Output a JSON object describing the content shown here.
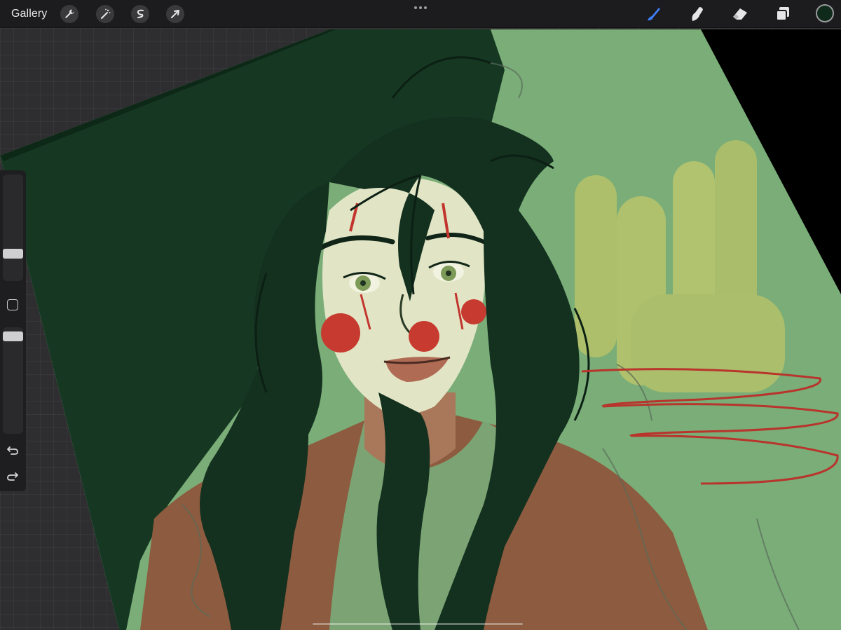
{
  "toolbar": {
    "gallery_label": "Gallery",
    "left_tools": [
      {
        "name": "actions",
        "icon": "wrench-icon"
      },
      {
        "name": "adjustments",
        "icon": "magic-wand-icon"
      },
      {
        "name": "selection",
        "icon": "selection-s-icon"
      },
      {
        "name": "transform",
        "icon": "arrow-cursor-icon"
      }
    ],
    "more_icon": "more-dots-icon",
    "right_tools": [
      {
        "name": "brush",
        "icon": "brush-icon",
        "active": true
      },
      {
        "name": "smudge",
        "icon": "smudge-icon",
        "active": false
      },
      {
        "name": "eraser",
        "icon": "eraser-icon",
        "active": false
      },
      {
        "name": "layers",
        "icon": "layers-icon",
        "active": false
      }
    ],
    "current_color": "#0f2a1a"
  },
  "sidebar": {
    "brush_size_icon": "size-slider",
    "opacity_icon": "opacity-slider",
    "modify_icon": "square-modify-icon",
    "undo_icon": "undo-icon",
    "redo_icon": "redo-icon"
  },
  "colors": {
    "accent": "#3d7ef5",
    "canvas_bg": "#7aad78",
    "hair": "#14301f",
    "skin": "#e3e6c8",
    "clown_red": "#c8382f",
    "shirt": "#8a5a3e"
  }
}
